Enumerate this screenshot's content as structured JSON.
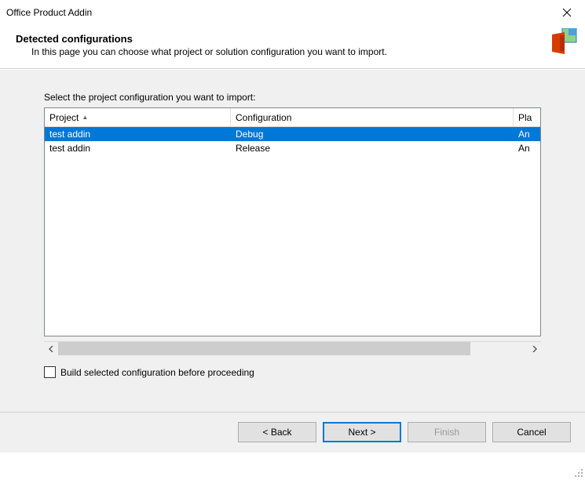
{
  "window": {
    "title": "Office Product Addin"
  },
  "header": {
    "title": "Detected configurations",
    "subtitle": "In this page you can choose what project or solution configuration you want to import."
  },
  "body": {
    "prompt": "Select the project configuration you want to import:",
    "columns": {
      "project": "Project",
      "configuration": "Configuration",
      "platform": "Pla"
    },
    "rows": [
      {
        "project": "test addin",
        "configuration": "Debug",
        "platform": "An",
        "selected": true
      },
      {
        "project": "test addin",
        "configuration": "Release",
        "platform": "An",
        "selected": false
      }
    ],
    "checkbox_label": "Build selected configuration before proceeding"
  },
  "footer": {
    "back": "< Back",
    "next": "Next >",
    "finish": "Finish",
    "cancel": "Cancel"
  }
}
